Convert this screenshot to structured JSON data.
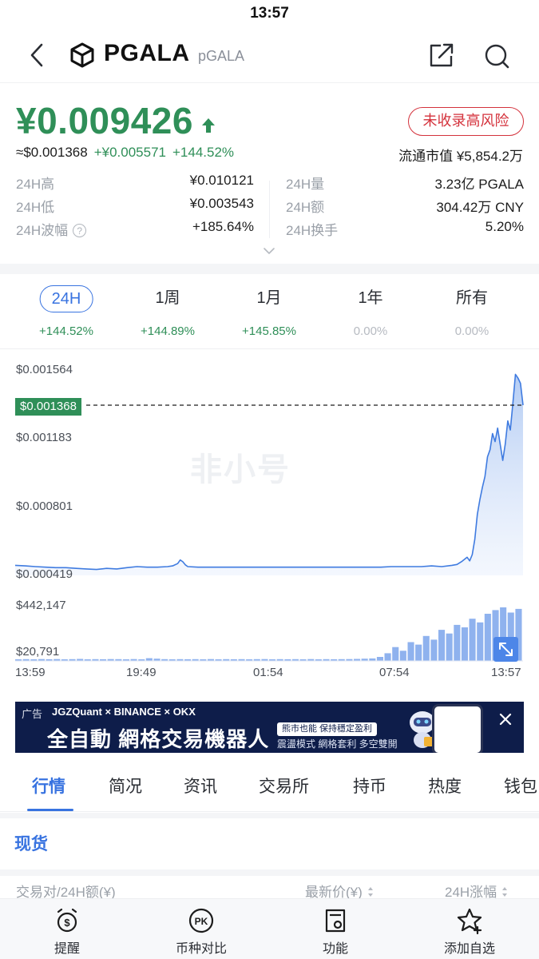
{
  "status_bar": {
    "time": "13:57"
  },
  "header": {
    "symbol": "PGALA",
    "name": "pGALA",
    "icons": {
      "back": "back-arrow-icon",
      "logo": "cube-logo-icon",
      "share": "share-icon",
      "search": "search-icon"
    }
  },
  "price": {
    "cny": "¥0.009426",
    "direction": "up",
    "risk_badge": "未收录高风险",
    "usd": "≈$0.001368",
    "change_cny": "+¥0.005571",
    "change_pct": "+144.52%",
    "market_cap": "流通市值 ¥5,854.2万"
  },
  "stats": {
    "left": [
      {
        "label": "24H高",
        "value": "¥0.010121"
      },
      {
        "label": "24H低",
        "value": "¥0.003543"
      },
      {
        "label": "24H波幅",
        "value": "+185.64%",
        "has_help": true
      }
    ],
    "right": [
      {
        "label": "24H量",
        "value": "3.23亿 PGALA"
      },
      {
        "label": "24H额",
        "value": "304.42万 CNY"
      },
      {
        "label": "24H换手",
        "value": "5.20%"
      }
    ]
  },
  "periods": [
    {
      "label": "24H",
      "change": "+144.52%",
      "active": true,
      "flat": false
    },
    {
      "label": "1周",
      "change": "+144.89%",
      "active": false,
      "flat": false
    },
    {
      "label": "1月",
      "change": "+145.85%",
      "active": false,
      "flat": false
    },
    {
      "label": "1年",
      "change": "0.00%",
      "active": false,
      "flat": true
    },
    {
      "label": "所有",
      "change": "0.00%",
      "active": false,
      "flat": true
    }
  ],
  "chart": {
    "y_labels": [
      "$0.001564",
      "$0.001183",
      "$0.000801",
      "$0.000419"
    ],
    "current_price_tag": "$0.001368",
    "watermark": "非小号",
    "volume_labels": [
      "$442,147",
      "$20,791"
    ],
    "x_labels": [
      "13:59",
      "19:49",
      "01:54",
      "07:54",
      "13:57"
    ],
    "line_color": "#3f7be0",
    "up_color": "#2f8f58"
  },
  "chart_data": {
    "type": "area",
    "ylim": [
      0.000419,
      0.001564
    ],
    "current_price": 0.001368,
    "x_ticks": [
      "13:59",
      "19:49",
      "01:54",
      "07:54",
      "13:57"
    ],
    "price_series": [
      [
        0.0,
        0.000475
      ],
      [
        0.02,
        0.000472
      ],
      [
        0.04,
        0.000468
      ],
      [
        0.06,
        0.000465
      ],
      [
        0.08,
        0.000462
      ],
      [
        0.1,
        0.000462
      ],
      [
        0.12,
        0.000458
      ],
      [
        0.14,
        0.000455
      ],
      [
        0.16,
        0.000452
      ],
      [
        0.18,
        0.000458
      ],
      [
        0.2,
        0.000455
      ],
      [
        0.22,
        0.000462
      ],
      [
        0.24,
        0.000468
      ],
      [
        0.26,
        0.000465
      ],
      [
        0.28,
        0.000465
      ],
      [
        0.3,
        0.000468
      ],
      [
        0.31,
        0.000472
      ],
      [
        0.32,
        0.000485
      ],
      [
        0.325,
        0.000505
      ],
      [
        0.33,
        0.000495
      ],
      [
        0.335,
        0.000478
      ],
      [
        0.34,
        0.000468
      ],
      [
        0.36,
        0.000465
      ],
      [
        0.38,
        0.000465
      ],
      [
        0.4,
        0.000465
      ],
      [
        0.42,
        0.000465
      ],
      [
        0.44,
        0.000465
      ],
      [
        0.46,
        0.000465
      ],
      [
        0.48,
        0.000465
      ],
      [
        0.5,
        0.000465
      ],
      [
        0.52,
        0.000465
      ],
      [
        0.54,
        0.000465
      ],
      [
        0.56,
        0.000465
      ],
      [
        0.58,
        0.000465
      ],
      [
        0.6,
        0.000465
      ],
      [
        0.62,
        0.000465
      ],
      [
        0.64,
        0.000465
      ],
      [
        0.66,
        0.000465
      ],
      [
        0.68,
        0.000465
      ],
      [
        0.7,
        0.000465
      ],
      [
        0.72,
        0.000465
      ],
      [
        0.74,
        0.000468
      ],
      [
        0.76,
        0.000468
      ],
      [
        0.78,
        0.000468
      ],
      [
        0.8,
        0.000468
      ],
      [
        0.82,
        0.000472
      ],
      [
        0.84,
        0.000468
      ],
      [
        0.86,
        0.000475
      ],
      [
        0.87,
        0.00048
      ],
      [
        0.88,
        0.000498
      ],
      [
        0.89,
        0.00052
      ],
      [
        0.895,
        0.0005
      ],
      [
        0.9,
        0.000535
      ],
      [
        0.905,
        0.00062
      ],
      [
        0.91,
        0.00076
      ],
      [
        0.915,
        0.00084
      ],
      [
        0.92,
        0.00091
      ],
      [
        0.925,
        0.00097
      ],
      [
        0.93,
        0.00108
      ],
      [
        0.935,
        0.00112
      ],
      [
        0.94,
        0.00121
      ],
      [
        0.945,
        0.001165
      ],
      [
        0.95,
        0.00124
      ],
      [
        0.955,
        0.00115
      ],
      [
        0.96,
        0.00106
      ],
      [
        0.965,
        0.00115
      ],
      [
        0.97,
        0.00128
      ],
      [
        0.975,
        0.00123
      ],
      [
        0.98,
        0.00138
      ],
      [
        0.985,
        0.00154
      ],
      [
        0.99,
        0.00152
      ],
      [
        0.995,
        0.00149
      ],
      [
        1.0,
        0.001368
      ]
    ],
    "volume_range": [
      20791,
      442147
    ],
    "volume_series": [
      20791,
      22000,
      21000,
      23000,
      21500,
      22500,
      21000,
      22000,
      24000,
      21000,
      22000,
      21500,
      23000,
      22000,
      21000,
      22500,
      21000,
      30000,
      26000,
      22000,
      21000,
      22000,
      21500,
      22000,
      21000,
      22500,
      21000,
      22000,
      21500,
      22000,
      21000,
      22000,
      23000,
      21000,
      22000,
      21500,
      22000,
      21000,
      22500,
      21000,
      22000,
      21500,
      22000,
      23000,
      24000,
      26000,
      28000,
      40000,
      70000,
      120000,
      90000,
      160000,
      140000,
      210000,
      180000,
      260000,
      230000,
      300000,
      280000,
      350000,
      320000,
      390000,
      420000,
      442147,
      400000,
      430000
    ]
  },
  "ad": {
    "tag": "广告",
    "brands": "JGZQuant × BINANCE × OKX",
    "headline": "全自動 網格交易機器人",
    "pill": "熊市也能 保持穩定盈利",
    "sub": "震盪模式 網格套利 多空雙開",
    "close_icon": "close-icon"
  },
  "main_tabs": [
    "行情",
    "简况",
    "资讯",
    "交易所",
    "持币",
    "热度",
    "钱包"
  ],
  "section_title": "现货",
  "table_header": {
    "pair": "交易对/24H额(¥)",
    "price": "最新价(¥)",
    "change": "24H涨幅"
  },
  "bottom_bar": [
    {
      "label": "提醒",
      "icon": "alarm-clock-icon"
    },
    {
      "label": "币种对比",
      "icon": "pk-compare-icon"
    },
    {
      "label": "功能",
      "icon": "tools-icon"
    },
    {
      "label": "添加自选",
      "icon": "star-add-icon"
    }
  ]
}
